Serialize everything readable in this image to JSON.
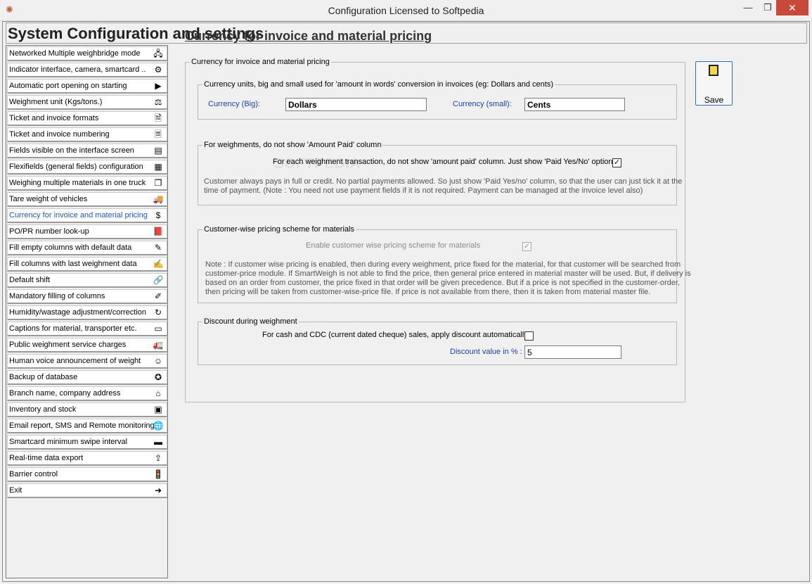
{
  "window": {
    "title": "Configuration  Licensed to Softpedia",
    "min_glyph": "—",
    "max_glyph": "❐",
    "close_glyph": "✕"
  },
  "header": {
    "title": "System Configuration and settings"
  },
  "sidebar": {
    "items": [
      {
        "label": "Networked Multiple weighbridge mode",
        "icon": "network-icon",
        "glyph": "🖧"
      },
      {
        "label": "Indicator interface, camera, smartcard ..",
        "icon": "gear-icon",
        "glyph": "⚙"
      },
      {
        "label": "Automatic port opening on starting",
        "icon": "play-icon",
        "glyph": "▶"
      },
      {
        "label": "Weighment unit (Kgs/tons.)",
        "icon": "scale-icon",
        "glyph": "⚖"
      },
      {
        "label": "Ticket and invoice formats",
        "icon": "document-icon",
        "glyph": "🗎"
      },
      {
        "label": "Ticket and invoice numbering",
        "icon": "document-list-icon",
        "glyph": "🗏"
      },
      {
        "label": "Fields visible on the interface screen",
        "icon": "form-icon",
        "glyph": "▤"
      },
      {
        "label": "Flexifields (general fields) configuration",
        "icon": "table-icon",
        "glyph": "▦"
      },
      {
        "label": "Weighing multiple materials in one truck",
        "icon": "copy-icon",
        "glyph": "❐"
      },
      {
        "label": "Tare weight of vehicles",
        "icon": "truck-icon",
        "glyph": "🚚"
      },
      {
        "label": "Currency for invoice and material pricing",
        "icon": "dollar-icon",
        "glyph": "$",
        "active": true
      },
      {
        "label": "PO/PR number look-up",
        "icon": "book-icon",
        "glyph": "📕"
      },
      {
        "label": "Fill empty columns with default data",
        "icon": "edit-icon",
        "glyph": "✎"
      },
      {
        "label": "Fill columns with last weighment data",
        "icon": "fill-icon",
        "glyph": "✍"
      },
      {
        "label": "Default shift",
        "icon": "link-icon",
        "glyph": "🔗"
      },
      {
        "label": "Mandatory filling of columns",
        "icon": "pen-icon",
        "glyph": "✐"
      },
      {
        "label": "Humidity/wastage adjustment/correction",
        "icon": "refresh-icon",
        "glyph": "↻"
      },
      {
        "label": "Captions for material, transporter etc.",
        "icon": "caption-icon",
        "glyph": "▭"
      },
      {
        "label": "Public weighment service charges",
        "icon": "truck-charge-icon",
        "glyph": "🚛"
      },
      {
        "label": "Human voice announcement of weight",
        "icon": "person-icon",
        "glyph": "☺"
      },
      {
        "label": "Backup of database",
        "icon": "backup-icon",
        "glyph": "✪"
      },
      {
        "label": "Branch name, company address",
        "icon": "building-icon",
        "glyph": "⌂"
      },
      {
        "label": "Inventory and stock",
        "icon": "inventory-icon",
        "glyph": "▣"
      },
      {
        "label": "Email report, SMS and Remote monitoring",
        "icon": "globe-icon",
        "glyph": "🌐"
      },
      {
        "label": "Smartcard minimum swipe interval",
        "icon": "card-icon",
        "glyph": "▬"
      },
      {
        "label": "Real-time data export",
        "icon": "export-icon",
        "glyph": "⇪"
      },
      {
        "label": "Barrier control",
        "icon": "traffic-light-icon",
        "glyph": "🚦"
      },
      {
        "label": "Exit",
        "icon": "exit-icon",
        "glyph": "➜"
      }
    ]
  },
  "main": {
    "title": "Currency for invoice and material pricing",
    "outer_legend": "Currency for invoice and material pricing",
    "currency_group": {
      "legend": "Currency units, big and small used for 'amount in words' conversion in invoices (eg: Dollars and cents)",
      "big_label": "Currency (Big):",
      "big_value": "Dollars",
      "small_label": "Currency (small):",
      "small_value": "Cents"
    },
    "amount_paid_group": {
      "legend": "For weighments, do not show 'Amount Paid' column",
      "checkbox_label": "For each weighment transaction, do not show 'amount paid' column. Just show 'Paid Yes/No' option",
      "checked": true,
      "note_line1": "Customer always pays in full or credit. No partial payments allowed. So just show 'Paid Yes/no' column, so that the user can just tick it at the",
      "note_line2": "time of payment. (Note : You need not use payment fields if it is not required. Payment can be managed at the invoice level also)"
    },
    "pricing_group": {
      "legend": "Customer-wise pricing scheme for materials",
      "checkbox_label": "Enable customer wise pricing scheme for materials",
      "checked": true,
      "note_line1": "Note : If customer wise pricing is enabled, then during every weighment, price fixed for the material, for that customer will be searched from",
      "note_line2": "customer-price module. If SmartWeigh is not able to find the price, then general price entered in material master will be used. But, if delivery is",
      "note_line3": "based on an order from customer, the price fixed in that order will be given precedence. But if a price is not specified in the customer-order,",
      "note_line4": "then pricing will be taken from customer-wise-price file. If price is not available from there, then it is taken from material master file."
    },
    "discount_group": {
      "legend": "Discount during weighment",
      "checkbox_label": "For cash and CDC (current dated cheque) sales, apply discount automatically",
      "checked": false,
      "value_label": "Discount value in % :",
      "value": "5"
    }
  },
  "save_button": {
    "label": "Save"
  },
  "watermark": "SOFTPEDIA"
}
